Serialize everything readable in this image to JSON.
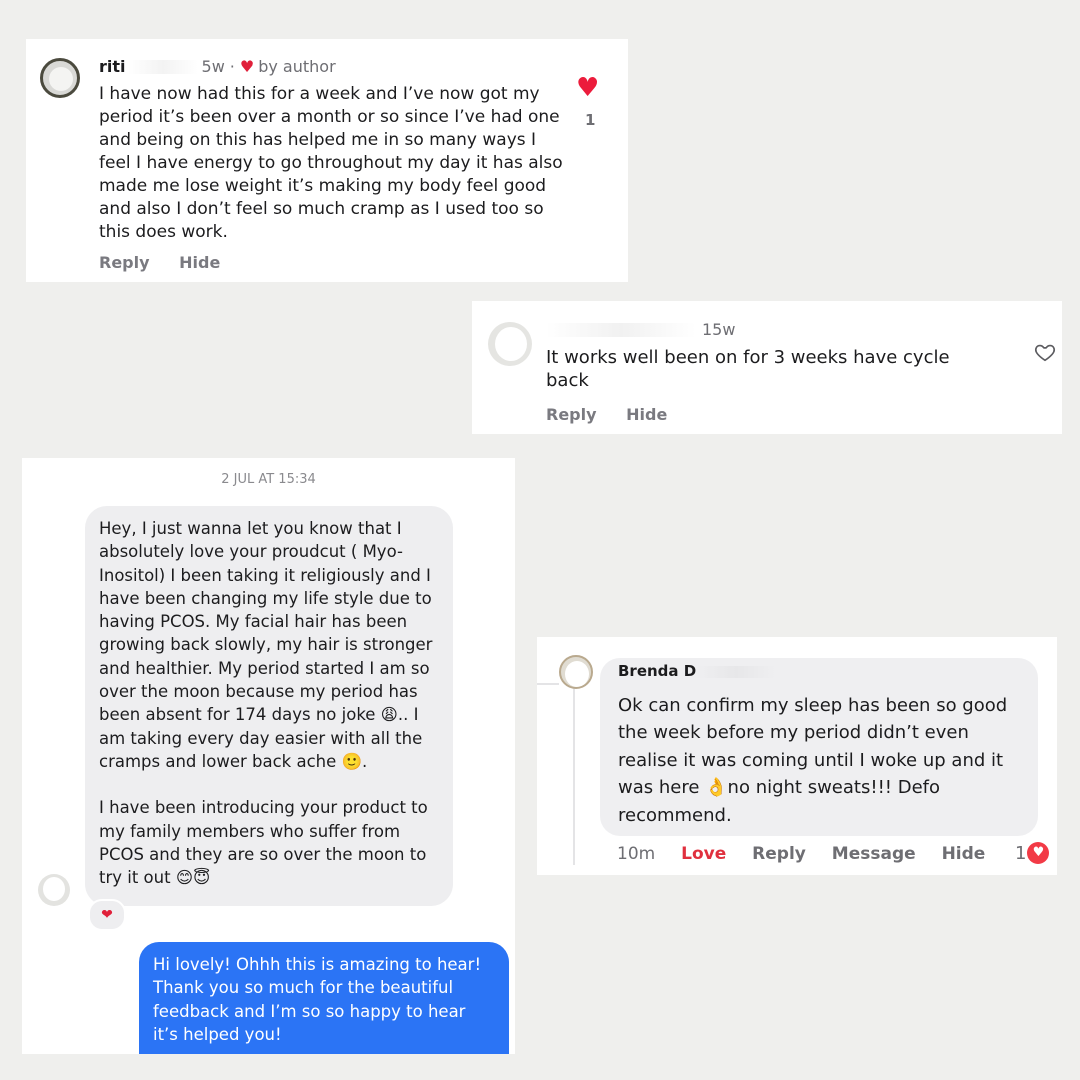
{
  "comment1": {
    "name": "riti",
    "age": "5w",
    "sep": "·",
    "author_badge": "by author",
    "text": "I have now had this for a week and I’ve now got my period it’s been over a month or so since I’ve had one and being on this has helped me in so many ways I feel I have energy to go throughout my day it has also made me lose weight it’s making my body feel good and also I don’t feel so much cramp as I used too so this does work.",
    "reply_label": "Reply",
    "hide_label": "Hide",
    "like_count": "1"
  },
  "comment2": {
    "age": "15w",
    "text": "It works well been on for 3 weeks have cycle back",
    "reply_label": "Reply",
    "hide_label": "Hide"
  },
  "dm": {
    "timestamp": "2 JUL AT 15:34",
    "incoming_p1": "Hey, I just wanna let you know that I absolutely love your proudcut ( Myo-Inositol) I been taking it religiously and I have been changing my life style due to having PCOS. My facial hair has been growing back slowly, my hair is stronger and healthier. My period started I am so over the moon because my period has been absent for 174 days no joke 😩.. I am taking every day easier with all the cramps and lower back ache 🙂.",
    "incoming_p2": "I have been introducing your product to my family members who suffer from PCOS and they are so over the moon to try it out 😊😇",
    "reaction": "❤",
    "outgoing": "Hi lovely! Ohhh this is amazing to hear! Thank you so much for the beautiful feedback and I’m so so happy to hear it’s helped you!"
  },
  "comment4": {
    "name": "Brenda D",
    "text": "Ok can confirm my sleep has been so good the week before my period didn’t even realise it was coming until I woke up and it was here 👌no night sweats!!! Defo recommend.",
    "time": "10m",
    "love_label": "Love",
    "reply_label": "Reply",
    "message_label": "Message",
    "hide_label": "Hide",
    "reaction_count": "1"
  },
  "colors": {
    "background": "#efefed",
    "like_red": "#ec1c3c",
    "outgoing_blue": "#2b74f5",
    "incoming_gray": "#eeeef0"
  },
  "icons": {
    "like_filled": "heart-filled-icon",
    "like_outline": "heart-outline-icon"
  }
}
